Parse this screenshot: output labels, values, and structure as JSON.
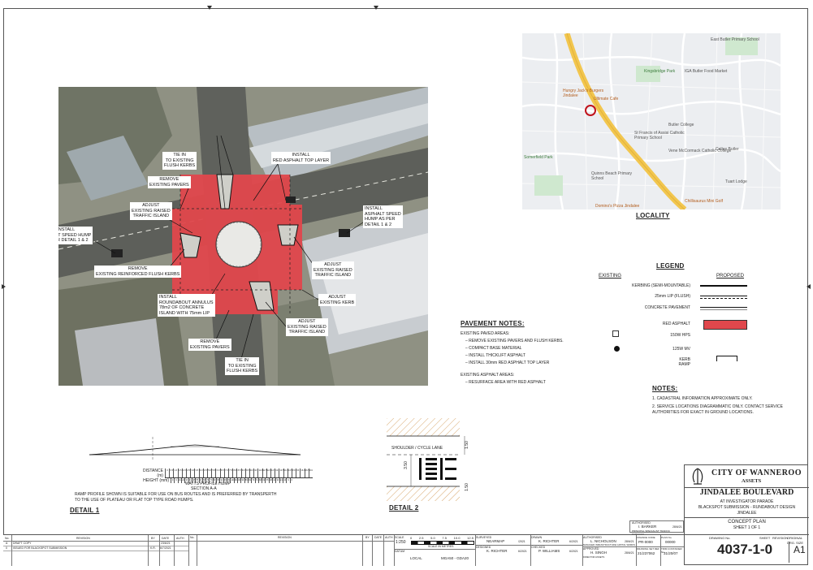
{
  "aerial": {
    "callouts": [
      {
        "id": "tie-in-top",
        "text": "TIE IN\nTO EXISTING\nFLUSH KERBS"
      },
      {
        "id": "remove-top",
        "text": "REMOVE\nEXISTING PAVERS"
      },
      {
        "id": "adjust-top",
        "text": "ADJUST\nEXISTING RAISED\nTRAFFIC ISLAND"
      },
      {
        "id": "install-red",
        "text": "INSTALL\nRED ASPHALT TOP LAYER"
      },
      {
        "id": "install-hump-right",
        "text": "INSTALL\nASPHALT SPEED\nHUMP AS PER\nDETAIL 1 & 2"
      },
      {
        "id": "install-hump-left",
        "text": "INSTALL\nASPHALT SPEED HUMP\nAS PER DETAIL 1 & 2"
      },
      {
        "id": "remove-kerbs",
        "text": "REMOVE\nEXISTING REINFORCED FLUSH KERBS"
      },
      {
        "id": "adjust-right",
        "text": "ADJUST\nEXISTING RAISED\nTRAFFIC ISLAND"
      },
      {
        "id": "adjust-kerb",
        "text": "ADJUST\nEXISTING KERB"
      },
      {
        "id": "install-annulus",
        "text": "INSTALL\nROUNDABOUT ANNULUS\n78m2 OF CONCRETE\nISLAND WITH 75mm LIP"
      },
      {
        "id": "adjust-bottom",
        "text": "ADJUST\nEXISTING RAISED\nTRAFFIC ISLAND"
      },
      {
        "id": "remove-bottom",
        "text": "REMOVE\nEXISTING PAVERS"
      },
      {
        "id": "tie-in-bottom",
        "text": "TIE IN\nTO EXISTING\nFLUSH KERBS"
      }
    ]
  },
  "locality": {
    "title": "LOCALITY",
    "labels": [
      "East Butler Primary School",
      "Hungry Jack's Burgers Jindalee",
      "Ultimate Cafe",
      "Kingsbridge Park",
      "IGA Butler Food Market",
      "Butler College",
      "St Francis of Assisi Catholic Primary School",
      "Vene McCormack Catholic College",
      "Caltex Butler",
      "Quinns Beach Primary School",
      "Tuart Lodge",
      "Chillisaurus Mini Golf",
      "Somerfield Park",
      "Domino's Pizza Jindalee"
    ]
  },
  "legend": {
    "title": "LEGEND",
    "col_existing": "EXISTING",
    "col_proposed": "PROPOSED",
    "items": [
      {
        "label": "KERBING (SEMI-MOUNTABLE)"
      },
      {
        "label": "25mm LIP (FLUSH)"
      },
      {
        "label": "CONCRETE PAVEMENT"
      },
      {
        "label": "RED ASPHALT"
      },
      {
        "label": "150W HPS"
      },
      {
        "label": "125W MV"
      },
      {
        "label": "KERB\nRAMP"
      }
    ],
    "red_color": "#e0474c"
  },
  "pavement_notes": {
    "title": "PAVEMENT NOTES:",
    "paved_heading": "EXISTING PAVED AREAS:",
    "paved_items": [
      "REMOVE EXISTING PAVERS AND FLUSH KERBS.",
      "COMPACT BASE MATERIAL",
      "INSTALL THICKLIFT ASPHALT",
      "INSTALL 30mm RED ASPHALT TOP LAYER"
    ],
    "asphalt_heading": "EXISTING ASPHALT AREAS:",
    "asphalt_items": [
      "RESURFACE AREA WITH RED ASPHALT"
    ]
  },
  "notes": {
    "title": "NOTES:",
    "items": [
      "CADASTRAL INFORMATION APPROXIMATE ONLY.",
      "SERVICE LOCATIONS DIAGRAMMATIC ONLY. CONTACT SERVICE AUTHORITIES FOR EXACT IN GROUND LOCATIONS."
    ]
  },
  "detail1": {
    "title": "DETAIL 1",
    "distance_label": "DISTANCE (m)",
    "distances": [
      "0",
      "0.5",
      "1.0",
      "1.5",
      "2.0",
      "2.5",
      "3.0",
      "3.5",
      "4.0",
      "4.5",
      "5.0",
      "5.5",
      "6.0",
      "6.5",
      "7.0",
      "7.5",
      "8.0",
      "8.5",
      "9.0",
      "9.5",
      "10.0",
      "10.5",
      "11.0",
      "11.5",
      "12.0",
      "12.5",
      "13.0",
      "13.5",
      "14.0",
      "14.5",
      "15.0",
      "15.5",
      "16.0",
      "16.5",
      "16.85"
    ],
    "height_label": "HEIGHT (mm)",
    "heights": [
      "0",
      "9",
      "16",
      "24",
      "33",
      "41",
      "48",
      "55",
      "62",
      "68",
      "74",
      "79",
      "84",
      "89",
      "93",
      "96",
      "99",
      "100",
      "99",
      "96",
      "93",
      "89",
      "84",
      "79",
      "74",
      "68",
      "62",
      "55",
      "48",
      "41",
      "33",
      "24",
      "16",
      "9",
      "0"
    ],
    "caption1": "WATTS PROFILE HUMP",
    "caption2": "SECTION A-A",
    "note": "RAMP PROFILE SHOWN IS SUITABLE FOR USE ON BUS ROUTES AND IS PREFERRED BY TRANSPERTH TO THE USE OF PLATEAU OR FLAT TOP TYPE ROAD HUMPS."
  },
  "detail2": {
    "title": "DETAIL 2",
    "lane_label": "SHOULDER / CYCLE LANE",
    "dim_a": "1.50",
    "dim_b": "3.50",
    "dim_c": "1.50"
  },
  "title_block": {
    "org_name": "CITY OF WANNEROO",
    "org_sub": "ASSETS",
    "street": "JINDALEE BOULEVARD",
    "line2": "AT INVESTIGATOR PARADE",
    "line3": "BLACKSPOT SUBMISSION - RUNDABOUT DESIGN",
    "line4": "JINDALEE",
    "plan": "CONCEPT PLAN",
    "sheet_line": "SHEET 1 OF 1",
    "drawing_no_label": "DRAWING No.",
    "sheet_label": "SHEET",
    "revision_label": "REVISION",
    "original_size_label": "ORIGINAL DRG. SIZE",
    "drawing_no": "4037-1-0",
    "size": "A1",
    "authorised_label": "AUTHORISED",
    "authorised_name": "I. BARKER",
    "authorised_role": "PRINCIPAL SPECIALIST TRAFFIC SERVICES",
    "authorised_date": "28/6/21"
  },
  "bottom_table": {
    "rev_header": [
      "No.",
      "REVISION",
      "BY",
      "DATE",
      "AUTH"
    ],
    "rev_rows": [
      [
        "A",
        "DRAFT COPY",
        "",
        "23/6/21",
        ""
      ],
      [
        "0",
        "ISSUED FOR BLACKSPOT SUBMISSION",
        "K.R.",
        "6/7/2021",
        ""
      ]
    ],
    "scale_label": "SCALE",
    "scale_value": "1:250",
    "scale_marks": [
      "0",
      "2.5",
      "5.0",
      "7.5",
      "10.0",
      "12.5"
    ],
    "scale_caption": "SCALE IN METRES",
    "datum_label": "DATUM",
    "datum_value": "LOCAL",
    "grid_value": "MGA50 - GDA20",
    "surveyed_label": "SURVEYED",
    "surveyed_name": "NEARMAP",
    "surveyed_date": "/2021",
    "designed_label": "DESIGNED",
    "designed_name": "K. RICHTER",
    "designed_date": "6/2021",
    "drawn_label": "DRAWN",
    "drawn_name": "K. RICHTER",
    "drawn_date": "6/2021",
    "checked_label": "CHECKED",
    "checked_name": "P. WILLIAMS",
    "checked_date": "6/2021",
    "authorised_label": "AUTHORISED",
    "authorised_name": "L. NICHOLSON",
    "authorised_role": "MANAGER INFRASTRUCTURE CAPITAL WORKS",
    "authorised_date": "28/6/21",
    "approved_label": "APPROVED",
    "approved_name": "H. SINGH",
    "approved_role": "DIRECTOR ASSETS",
    "approved_date": "28/6/21",
    "finance_label": "FINANCE CODE",
    "finance_code": "PR-0000",
    "plan_no_label": "PLAN No.",
    "plan_no": "00000",
    "drawing_set_label": "DRAWING SET REF",
    "drawing_set": "21/237062",
    "trim_label": "TRIM CONTAINER No.",
    "trim_no": "31/20/07"
  }
}
